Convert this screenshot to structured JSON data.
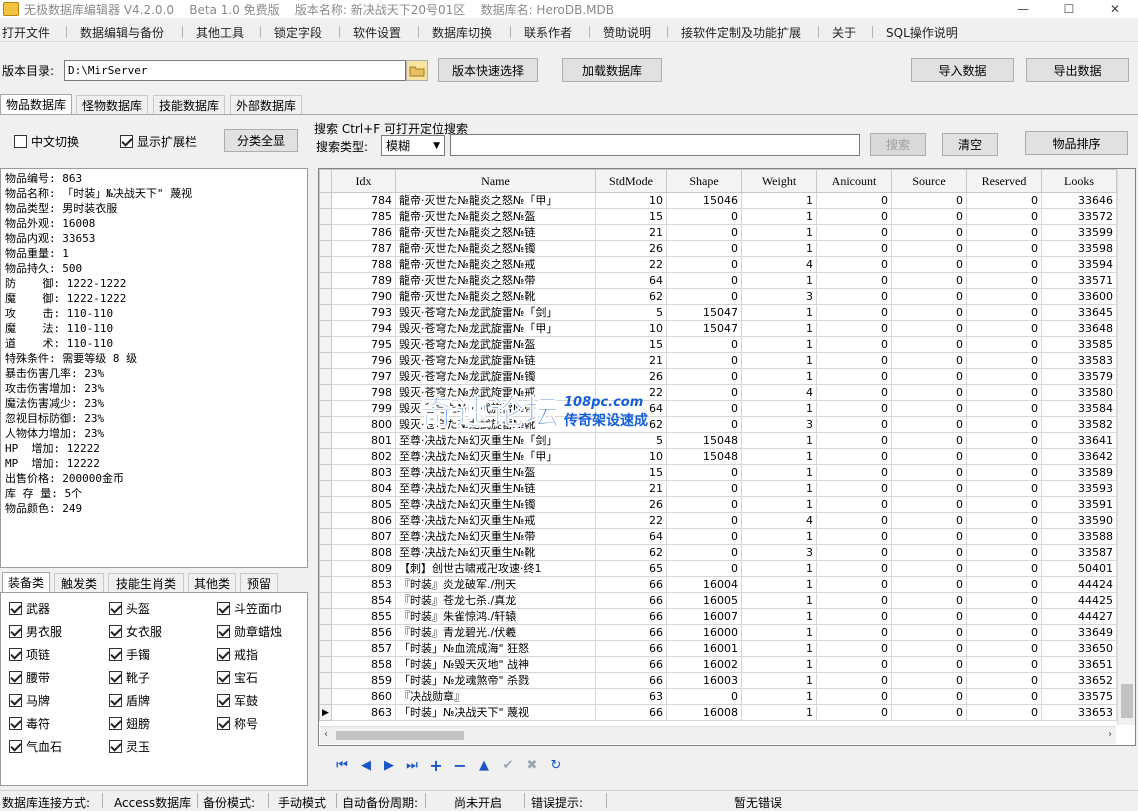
{
  "titlebar": {
    "title": "无极数据库编辑器 V4.2.0.0    Beta 1.0 免费版    版本名称: 新决战天下20号01区    数据库名: HeroDB.MDB",
    "min_icon": "—",
    "max_icon": "☐",
    "close_icon": "✕"
  },
  "menu": [
    "打开文件",
    "数据编辑与备份",
    "其他工具",
    "锁定字段",
    "软件设置",
    "数据库切换",
    "联系作者",
    "赞助说明",
    "接软件定制及功能扩展",
    "关于",
    "SQL操作说明"
  ],
  "toolbar": {
    "dir_label": "版本目录:",
    "dir_value": "D:\\MirServer",
    "quick_select": "版本快速选择",
    "load_db": "加载数据库",
    "import": "导入数据",
    "export": "导出数据"
  },
  "tabs": [
    "物品数据库",
    "怪物数据库",
    "技能数据库",
    "外部数据库"
  ],
  "options": {
    "chinese_switch": "中文切换",
    "show_ext": "显示扩展栏",
    "show_all": "分类全显"
  },
  "search": {
    "hint": "搜索  Ctrl+F 可打开定位搜索",
    "type_label": "搜索类型:",
    "type_value": "模糊",
    "query": "",
    "search_btn": "搜索",
    "clear_btn": "清空",
    "sort_btn": "物品排序"
  },
  "info_lines": [
    "物品编号: 863",
    "物品名称: 「时装」№决战天下\" 蔑视",
    "物品类型: 男时装衣服",
    "物品外观: 16008",
    "物品内观: 33653",
    "物品重量: 1",
    "物品持久: 500",
    "防    御: 1222-1222",
    "魔    御: 1222-1222",
    "攻    击: 110-110",
    "魔    法: 110-110",
    "道    术: 110-110",
    "特殊条件: 需要等级 8 级",
    "暴击伤害几率: 23%",
    "攻击伤害增加: 23%",
    "魔法伤害减少: 23%",
    "忽视目标防御: 23%",
    "人物体力增加: 23%",
    "HP  增加: 12222",
    "MP  增加: 12222",
    "出售价格: 200000金币",
    "库 存 量: 5个",
    "物品颜色: 249"
  ],
  "category_tabs": [
    "装备类",
    "触发类",
    "技能生肖类",
    "其他类",
    "预留"
  ],
  "categories": [
    "武器",
    "头盔",
    "斗笠面巾",
    "男衣服",
    "女衣服",
    "勋章蜡烛",
    "项链",
    "手镯",
    "戒指",
    "腰带",
    "靴子",
    "宝石",
    "马牌",
    "盾牌",
    "军鼓",
    "毒符",
    "翅膀",
    "称号",
    "气血石",
    "灵玉"
  ],
  "grid": {
    "columns": [
      "Idx",
      "Name",
      "StdMode",
      "Shape",
      "Weight",
      "Anicount",
      "Source",
      "Reserved",
      "Looks"
    ],
    "rows": [
      [
        "784",
        "龍帝·灭世た№龍炎之怒№「甲」",
        "10",
        "15046",
        "1",
        "0",
        "0",
        "0",
        "33646"
      ],
      [
        "785",
        "龍帝·灭世た№龍炎之怒№盔",
        "15",
        "0",
        "1",
        "0",
        "0",
        "0",
        "33572"
      ],
      [
        "786",
        "龍帝·灭世た№龍炎之怒№链",
        "21",
        "0",
        "1",
        "0",
        "0",
        "0",
        "33599"
      ],
      [
        "787",
        "龍帝·灭世た№龍炎之怒№镯",
        "26",
        "0",
        "1",
        "0",
        "0",
        "0",
        "33598"
      ],
      [
        "788",
        "龍帝·灭世た№龍炎之怒№戒",
        "22",
        "0",
        "4",
        "0",
        "0",
        "0",
        "33594"
      ],
      [
        "789",
        "龍帝·灭世た№龍炎之怒№带",
        "64",
        "0",
        "1",
        "0",
        "0",
        "0",
        "33571"
      ],
      [
        "790",
        "龍帝·灭世た№龍炎之怒№靴",
        "62",
        "0",
        "3",
        "0",
        "0",
        "0",
        "33600"
      ],
      [
        "793",
        "毁灭·苍穹た№龙武旋雷№「剑」",
        "5",
        "15047",
        "1",
        "0",
        "0",
        "0",
        "33645"
      ],
      [
        "794",
        "毁灭·苍穹た№龙武旋雷№「甲」",
        "10",
        "15047",
        "1",
        "0",
        "0",
        "0",
        "33648"
      ],
      [
        "795",
        "毁灭·苍穹た№龙武旋雷№盔",
        "15",
        "0",
        "1",
        "0",
        "0",
        "0",
        "33585"
      ],
      [
        "796",
        "毁灭·苍穹た№龙武旋雷№链",
        "21",
        "0",
        "1",
        "0",
        "0",
        "0",
        "33583"
      ],
      [
        "797",
        "毁灭·苍穹た№龙武旋雷№镯",
        "26",
        "0",
        "1",
        "0",
        "0",
        "0",
        "33579"
      ],
      [
        "798",
        "毁灭·苍穹た№龙武旋雷№戒",
        "22",
        "0",
        "4",
        "0",
        "0",
        "0",
        "33580"
      ],
      [
        "799",
        "毁灭·苍穹た№龙武旋雷№带",
        "64",
        "0",
        "1",
        "0",
        "0",
        "0",
        "33584"
      ],
      [
        "800",
        "毁灭·苍穹た№龙武旋雷№靴",
        "62",
        "0",
        "3",
        "0",
        "0",
        "0",
        "33582"
      ],
      [
        "801",
        "至尊·决战た№幻灭重生№「剑」",
        "5",
        "15048",
        "1",
        "0",
        "0",
        "0",
        "33641"
      ],
      [
        "802",
        "至尊·决战た№幻灭重生№「甲」",
        "10",
        "15048",
        "1",
        "0",
        "0",
        "0",
        "33642"
      ],
      [
        "803",
        "至尊·决战た№幻灭重生№盔",
        "15",
        "0",
        "1",
        "0",
        "0",
        "0",
        "33589"
      ],
      [
        "804",
        "至尊·决战た№幻灭重生№链",
        "21",
        "0",
        "1",
        "0",
        "0",
        "0",
        "33593"
      ],
      [
        "805",
        "至尊·决战た№幻灭重生№镯",
        "26",
        "0",
        "1",
        "0",
        "0",
        "0",
        "33591"
      ],
      [
        "806",
        "至尊·决战た№幻灭重生№戒",
        "22",
        "0",
        "4",
        "0",
        "0",
        "0",
        "33590"
      ],
      [
        "807",
        "至尊·决战た№幻灭重生№带",
        "64",
        "0",
        "1",
        "0",
        "0",
        "0",
        "33588"
      ],
      [
        "808",
        "至尊·决战た№幻灭重生№靴",
        "62",
        "0",
        "3",
        "0",
        "0",
        "0",
        "33587"
      ],
      [
        "809",
        "【刺】创世古啸戒卍攻速·终1",
        "65",
        "0",
        "1",
        "0",
        "0",
        "0",
        "50401"
      ],
      [
        "853",
        "『时装』炎龙破军./刑天",
        "66",
        "16004",
        "1",
        "0",
        "0",
        "0",
        "44424"
      ],
      [
        "854",
        "『时装』苍龙七杀./真龙",
        "66",
        "16005",
        "1",
        "0",
        "0",
        "0",
        "44425"
      ],
      [
        "855",
        "『时装』朱雀惊鸿./轩辕",
        "66",
        "16007",
        "1",
        "0",
        "0",
        "0",
        "44427"
      ],
      [
        "856",
        "『时装』青龙碧光./伏羲",
        "66",
        "16000",
        "1",
        "0",
        "0",
        "0",
        "33649"
      ],
      [
        "857",
        "「时装」№血流成海\" 狂怒",
        "66",
        "16001",
        "1",
        "0",
        "0",
        "0",
        "33650"
      ],
      [
        "858",
        "「时装」№毁天灭地\" 战神",
        "66",
        "16002",
        "1",
        "0",
        "0",
        "0",
        "33651"
      ],
      [
        "859",
        "「时装」№龙魂煞帝\" 杀戮",
        "66",
        "16003",
        "1",
        "0",
        "0",
        "0",
        "33652"
      ],
      [
        "860",
        "『决战勋章』",
        "63",
        "0",
        "1",
        "0",
        "0",
        "0",
        "33575"
      ],
      [
        "863",
        "「时装」№决战天下\" 蔑视",
        "66",
        "16008",
        "1",
        "0",
        "0",
        "0",
        "33653"
      ]
    ]
  },
  "nav_icons": [
    "first-record",
    "prior-record",
    "next-record",
    "last-record",
    "insert-record",
    "delete-record",
    "edit-record",
    "post-edit",
    "cancel-edit",
    "refresh-data"
  ],
  "watermark": {
    "main": "奇速论坛",
    "sub1": "108pc.com",
    "sub2": "传奇架设速成"
  },
  "statusbar": {
    "conn_label": "数据库连接方式:",
    "conn_value": "Access数据库",
    "backup_label": "备份模式:",
    "backup_value": "手动模式",
    "auto_label": "自动备份周期:",
    "auto_value": "尚未开启",
    "error_label": "错误提示:",
    "error_value": "暂无错误"
  },
  "colors": {
    "accent": "#1b56c4",
    "watermark": "#1560d8"
  }
}
